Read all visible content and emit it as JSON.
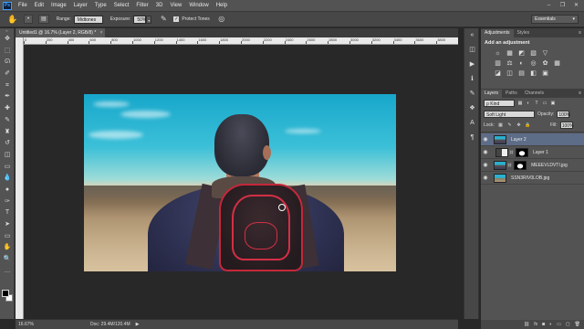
{
  "app": {
    "logo": "Ps"
  },
  "menu": [
    "File",
    "Edit",
    "Image",
    "Layer",
    "Type",
    "Select",
    "Filter",
    "3D",
    "View",
    "Window",
    "Help"
  ],
  "window_controls": [
    "–",
    "❐",
    "✕"
  ],
  "options_bar": {
    "range_label": "Range:",
    "range_value": "Midtones",
    "exposure_label": "Exposure:",
    "exposure_value": "50%",
    "protect_label": "Protect Tones",
    "protect_checked": "✓",
    "workspace": "Essentials"
  },
  "document": {
    "tab_title": "Untitled1 @ 16.7% (Layer 2, RGB/8) *",
    "close": "×"
  },
  "ruler_ticks": [
    "0",
    "200",
    "400",
    "600",
    "800",
    "1000",
    "1200",
    "1400",
    "1600",
    "1800",
    "2000",
    "2200",
    "2400",
    "2600",
    "2800",
    "3000",
    "3200",
    "3400",
    "3600",
    "3800"
  ],
  "status": {
    "zoom": "16.67%",
    "doc": "Doc: 29.4M/120.4M",
    "more": "▶"
  },
  "panels": {
    "adjustments": {
      "tabs": [
        "Adjustments",
        "Styles"
      ],
      "title": "Add an adjustment",
      "row1": [
        "☼",
        "▦",
        "◩",
        "▧",
        "▽"
      ],
      "row2": [
        "▥",
        "⚖",
        "◐",
        "◎",
        "✿",
        "▦"
      ],
      "row3": [
        "◪",
        "◫",
        "▤",
        "◧",
        "▣"
      ]
    },
    "layers": {
      "tabs": [
        "Layers",
        "Paths",
        "Channels"
      ],
      "kind": "ρ Kind",
      "blend_mode": "Soft Light",
      "opacity_label": "Opacity:",
      "opacity_value": "100%",
      "lock_label": "Lock:",
      "fill_label": "Fill:",
      "fill_value": "100%",
      "items": [
        {
          "name": "Layer 2",
          "selected": true
        },
        {
          "name": "Layer 1",
          "selected": false
        },
        {
          "name": "MEEEVLDVTI.jpg",
          "selected": false
        },
        {
          "name": "SSN3RIV0LOB.jpg",
          "selected": false
        }
      ],
      "bottom_icons": [
        "⛓",
        "fx",
        "◙",
        "◐",
        "▭",
        "▢",
        "🗑"
      ]
    }
  }
}
